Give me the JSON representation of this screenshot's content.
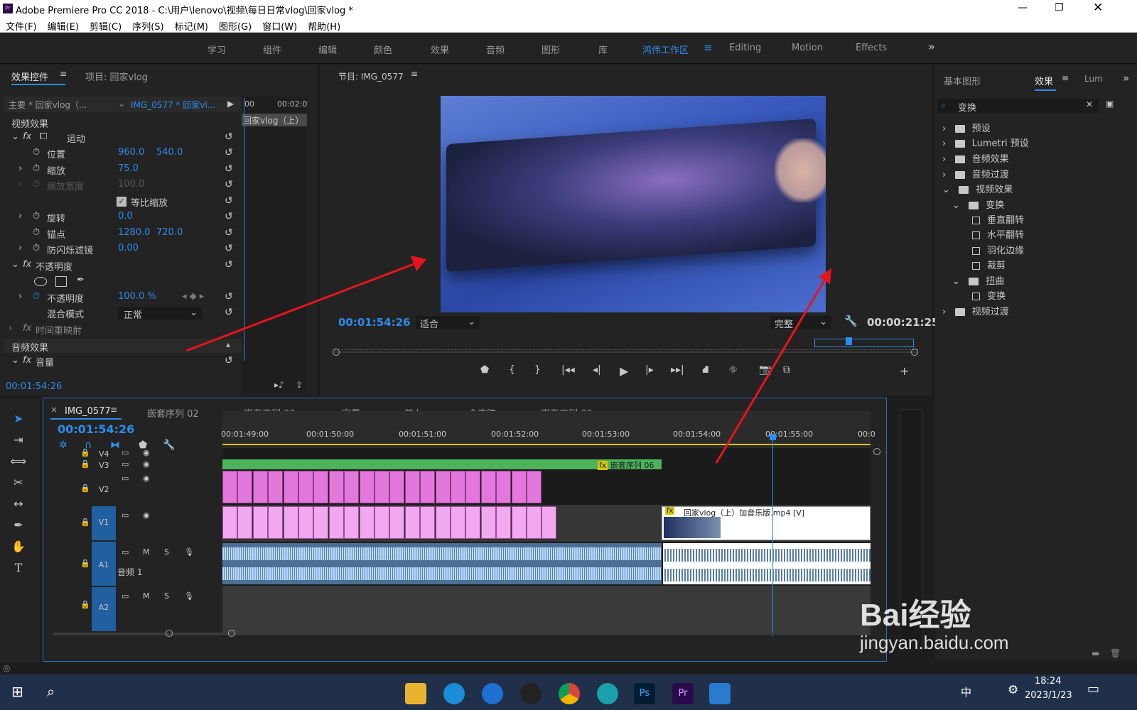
{
  "window": {
    "title": "Adobe Premiere Pro CC 2018 - C:\\用户\\lenovo\\视频\\每日日常vlog\\回家vlog *",
    "app_icon": "Pr"
  },
  "menu": [
    "文件(F)",
    "编辑(E)",
    "剪辑(C)",
    "序列(S)",
    "标记(M)",
    "图形(G)",
    "窗口(W)",
    "帮助(H)"
  ],
  "workspaces": [
    "学习",
    "组件",
    "编辑",
    "颜色",
    "效果",
    "音频",
    "图形",
    "库",
    "鸿伟工作区",
    "Editing",
    "Motion",
    "Effects"
  ],
  "active_workspace": "鸿伟工作区",
  "effect_controls": {
    "tab_active": "效果控件",
    "tab_project": "项目: 回家vlog",
    "source_label": "主要 * 回家vlog（...",
    "clip_label": "IMG_0577 * 回家vl...",
    "mini_time_start": "00",
    "mini_time_end": "00:02:0",
    "mini_clip_label": "回家vlog（上）",
    "video_effects": "视频效果",
    "motion": "运动",
    "position": {
      "label": "位置",
      "x": "960.0",
      "y": "540.0"
    },
    "scale": {
      "label": "缩放",
      "value": "75.0"
    },
    "scale_width": {
      "label": "缩放宽度",
      "value": "100.0"
    },
    "uniform_scale": "等比缩放",
    "rotation": {
      "label": "旋转",
      "value": "0.0"
    },
    "anchor": {
      "label": "锚点",
      "x": "1280.0",
      "y": "720.0"
    },
    "anti_flicker": {
      "label": "防闪烁滤镜",
      "value": "0.00"
    },
    "opacity_group": "不透明度",
    "opacity": {
      "label": "不透明度",
      "value": "100.0 %"
    },
    "blend": {
      "label": "混合模式",
      "value": "正常"
    },
    "time_remap": "时间重映射",
    "audio_effects": "音频效果",
    "volume": "音量",
    "timecode": "00:01:54:26"
  },
  "program": {
    "title": "节目: IMG_0577",
    "timecode": "00:01:54:26",
    "fit": "适合",
    "quality": "完整",
    "duration": "00:00:21:25"
  },
  "timeline": {
    "tabs": [
      "IMG_0577",
      "嵌套序列 02",
      "嵌套序列 03",
      "字幕",
      "美女",
      "合电脑",
      "嵌套序列 06"
    ],
    "timecode": "00:01:54:26",
    "ruler": [
      "00:01:49:00",
      "00:01:50:00",
      "00:01:51:00",
      "00:01:52:00",
      "00:01:53:00",
      "00:01:54:00",
      "00:01:55:00",
      "00:0"
    ],
    "tracks": {
      "v4": "V4",
      "v3": "V3",
      "v2": "V2",
      "v1": "V1",
      "a1": "A1",
      "a2": "A2",
      "audio1": "音频 1",
      "m": "M",
      "s": "S"
    },
    "nested_label": "嵌套序列 06",
    "clip_label": "回家vlog（上）加音乐版.mp4 [V]"
  },
  "effects_panel": {
    "tabs": [
      "基本图形",
      "效果",
      "Lum"
    ],
    "search": "变换",
    "items": [
      "预设",
      "Lumetri 预设",
      "音频效果",
      "音频过渡",
      "视频效果",
      "变换",
      "垂直翻转",
      "水平翻转",
      "羽化边缘",
      "裁剪",
      "扭曲",
      "变换",
      "视频过渡"
    ]
  },
  "taskbar": {
    "time": "18:24",
    "date": "2023/1/23",
    "ime": "中"
  },
  "watermark": {
    "text": "Bai经验",
    "url": "jingyan.baidu.com"
  }
}
